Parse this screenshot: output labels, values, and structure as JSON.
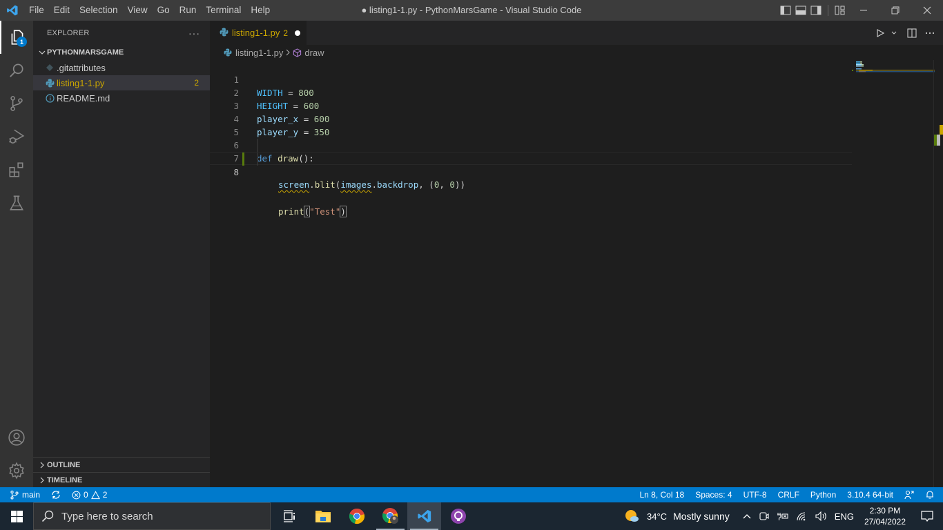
{
  "window": {
    "title": "● listing1-1.py - PythonMarsGame - Visual Studio Code",
    "menu": [
      "File",
      "Edit",
      "Selection",
      "View",
      "Go",
      "Run",
      "Terminal",
      "Help"
    ]
  },
  "activity_bar": {
    "explorer_badge": "1",
    "items": [
      "explorer",
      "search",
      "source-control",
      "run-and-debug",
      "extensions",
      "testing"
    ],
    "bottom_items": [
      "accounts",
      "manage"
    ]
  },
  "sidebar": {
    "header": "EXPLORER",
    "more": "···",
    "folder": "PYTHONMARSGAME",
    "files": [
      {
        "name": ".gitattributes",
        "icon": "git-icon",
        "count": ""
      },
      {
        "name": "listing1-1.py",
        "icon": "python-icon",
        "count": "2",
        "selected": true
      },
      {
        "name": "README.md",
        "icon": "info-icon",
        "count": ""
      }
    ],
    "outline": "OUTLINE",
    "timeline": "TIMELINE"
  },
  "editor": {
    "tab": {
      "name": "listing1-1.py",
      "problems": "2",
      "dirty": true
    },
    "breadcrumb": {
      "file": "listing1-1.py",
      "symbol": "draw"
    },
    "lines": [
      {
        "n": "1"
      },
      {
        "n": "2"
      },
      {
        "n": "3"
      },
      {
        "n": "4"
      },
      {
        "n": "5"
      },
      {
        "n": "6"
      },
      {
        "n": "7"
      },
      {
        "n": "8"
      }
    ],
    "tokens": {
      "l1": [
        "WIDTH",
        " = ",
        "800"
      ],
      "l2": [
        "HEIGHT",
        " = ",
        "600"
      ],
      "l3": [
        "player_x",
        " = ",
        "600"
      ],
      "l4": [
        "player_y",
        " = ",
        "350"
      ],
      "l6": [
        "def",
        " ",
        "draw",
        "():"
      ],
      "l7": [
        "screen",
        ".",
        "blit",
        "(",
        "images",
        ".",
        "backdrop",
        ", (",
        "0",
        ", ",
        "0",
        "))"
      ],
      "l8": [
        "print",
        "(",
        "\"Test\"",
        ")"
      ]
    }
  },
  "status_bar": {
    "branch": "main",
    "errors": "0",
    "warnings": "2",
    "position": "Ln 8, Col 18",
    "spaces": "Spaces: 4",
    "encoding": "UTF-8",
    "eol": "CRLF",
    "language": "Python",
    "interpreter": "3.10.4 64-bit"
  },
  "taskbar": {
    "search_placeholder": "Type here to search",
    "weather": {
      "temp": "34°C",
      "desc": "Mostly sunny"
    },
    "language": "ENG",
    "time": "2:30 PM",
    "date": "27/04/2022"
  }
}
